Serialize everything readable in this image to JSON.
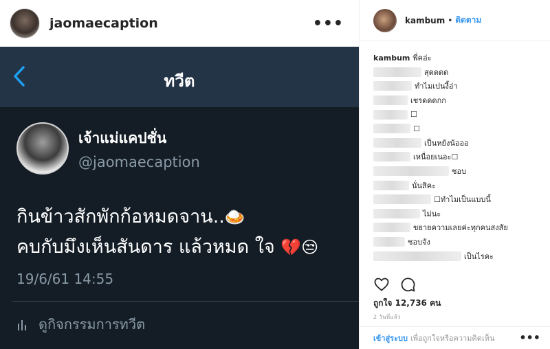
{
  "post": {
    "username": "jaomaecaption",
    "more_label": "•••"
  },
  "tweet": {
    "nav_title": "ทวีต",
    "display_name": "เจ้าแม่แคปชั่น",
    "handle": "@jaomaecaption",
    "line1": "กินข้าวสักพักก้อหมดจาน..",
    "line1_emoji": "🍛",
    "line2": "คบกับมึงเห็นสันดาร แล้วหมด ใจ",
    "line2_emoji": "💔😒",
    "timestamp": "19/6/61 14:55",
    "activity_label": "ดูกิจกรรมการทวีต"
  },
  "sidebar": {
    "account": "kambum",
    "dot": "•",
    "follow_label": "ติดตาม",
    "caption_user": "kambum",
    "caption_text": "พี่คอ่ะ",
    "comments": [
      {
        "text": "สุดดดด"
      },
      {
        "text": "ทำไมเปนงี้อ่า"
      },
      {
        "text": "เชรดดดกก"
      },
      {
        "text": "☐"
      },
      {
        "text": "☐"
      },
      {
        "text": "เป็นหยังน้อออ"
      },
      {
        "text": "เหนื่อยเนอะ☐"
      },
      {
        "text": "ชอบ"
      },
      {
        "text": "นั่นสิคะ"
      },
      {
        "text": "☐ทำไมเป็นแบบนี้"
      },
      {
        "text": "ไม่นะ"
      },
      {
        "text": "ขยายความเลยค่ะทุกคนสงสัย"
      },
      {
        "text": "ชอบจัง"
      },
      {
        "text": "เป็นไรคะ"
      }
    ],
    "likes_label": "ถูกใจ 12,736 คน",
    "time_ago": "2 วันที่แล้ว",
    "login_label": "เข้าสู่ระบบ",
    "login_rest": "เพื่อถูกใจหรือความคิดเห็น",
    "more_label": "•••"
  }
}
